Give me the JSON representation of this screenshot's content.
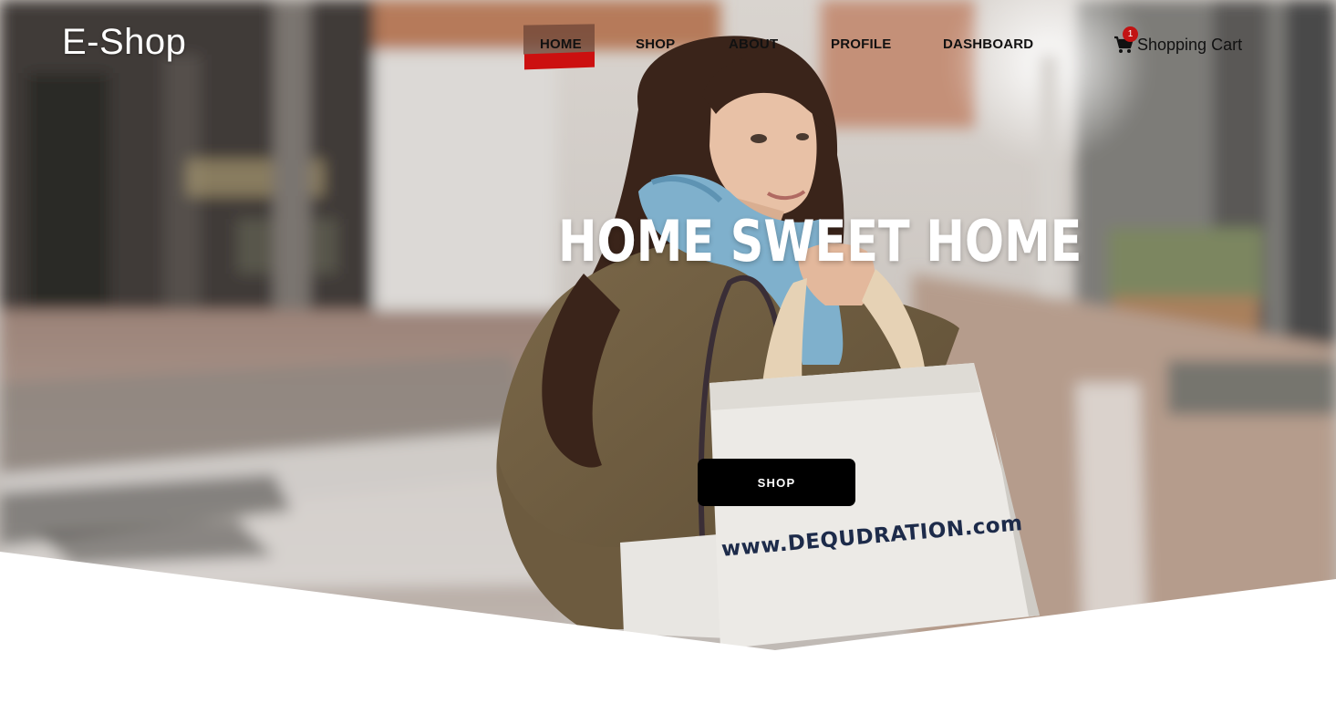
{
  "header": {
    "logo": "E-Shop",
    "nav": [
      {
        "label": "HOME",
        "active": true
      },
      {
        "label": "SHOP",
        "active": false
      },
      {
        "label": "ABOUT",
        "active": false
      },
      {
        "label": "PROFILE",
        "active": false
      },
      {
        "label": "DASHBOARD",
        "active": false
      }
    ],
    "cart": {
      "label": "Shopping Cart",
      "count": "1",
      "icon": "shopping-cart-icon"
    }
  },
  "hero": {
    "headline": "HOME SWEET HOME",
    "cta": "SHOP",
    "bag_print": "www.DEQUDRATION.com"
  },
  "colors": {
    "active_accent": "#cc1010",
    "badge": "#c21313",
    "button_bg": "#000000",
    "button_text": "#ffffff"
  }
}
